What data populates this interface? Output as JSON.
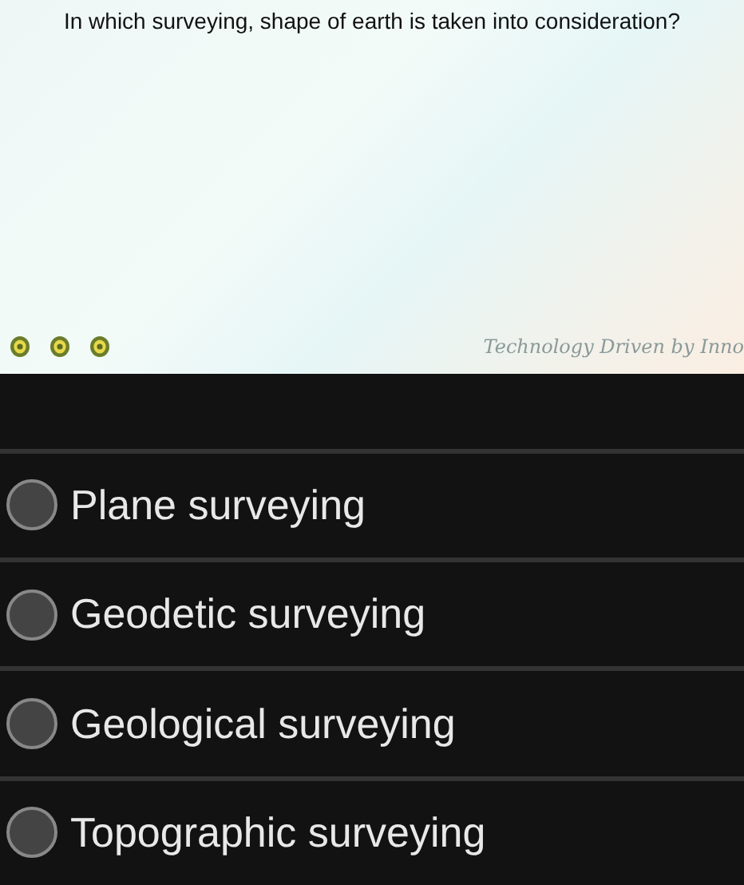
{
  "question": {
    "text": "In which surveying, shape of earth is taken into consideration?",
    "tagline": "Technology Driven by Inno"
  },
  "options": [
    {
      "label": "Plane surveying",
      "selected": false
    },
    {
      "label": "Geodetic surveying",
      "selected": false
    },
    {
      "label": "Geological surveying",
      "selected": false
    },
    {
      "label": "Topographic surveying",
      "selected": false
    }
  ]
}
